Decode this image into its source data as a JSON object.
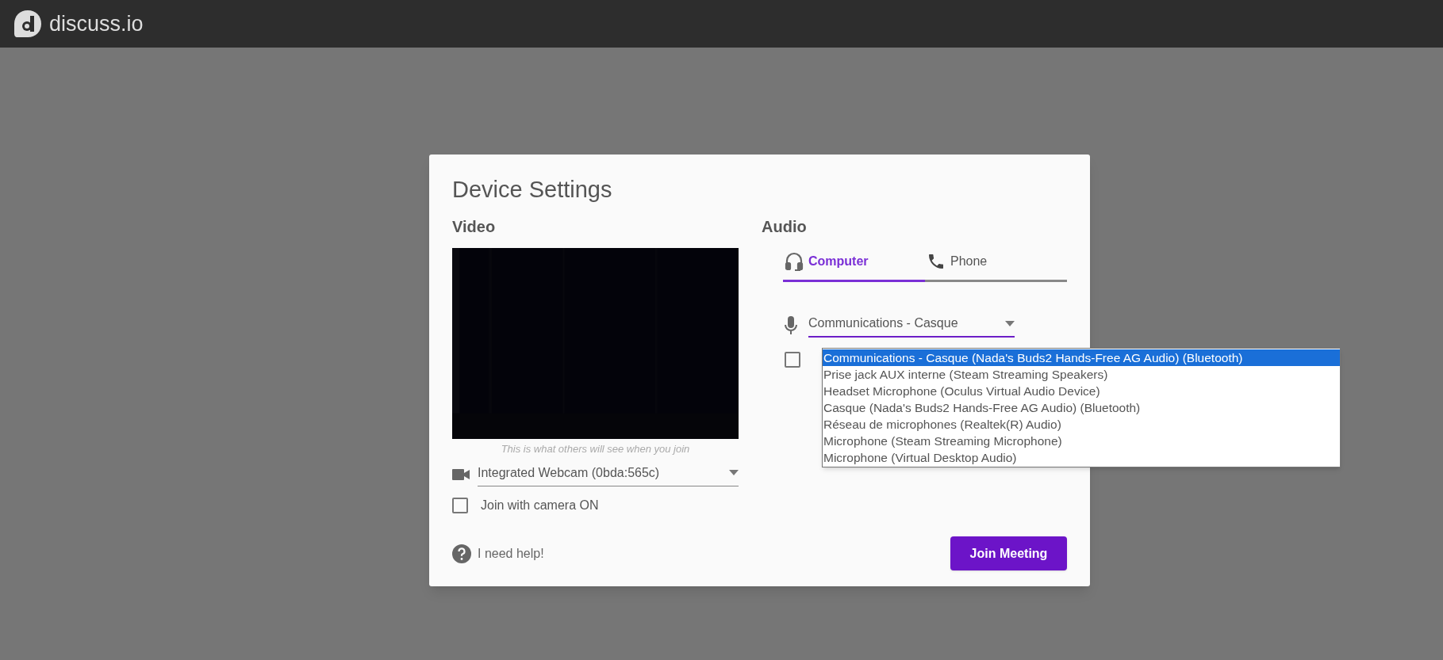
{
  "header": {
    "logo_text": "discuss.io"
  },
  "dialog": {
    "title": "Device Settings",
    "video": {
      "heading": "Video",
      "caption": "This is what others will see when you join",
      "camera_select": {
        "value": "Integrated Webcam (0bda:565c)"
      },
      "join_camera_on": {
        "label": "Join with camera ON",
        "checked": false
      }
    },
    "audio": {
      "heading": "Audio",
      "tabs": [
        {
          "label": "Computer",
          "kind": "headset",
          "selected": true
        },
        {
          "label": "Phone",
          "kind": "phone",
          "selected": false
        }
      ],
      "mic_select": {
        "value": "Communications - Casque",
        "expanded": true,
        "options": [
          {
            "label": "Communications - Casque (Nada's Buds2 Hands-Free AG Audio) (Bluetooth)",
            "selected": true
          },
          {
            "label": "Prise jack AUX interne (Steam Streaming Speakers)",
            "selected": false
          },
          {
            "label": "Headset Microphone (Oculus Virtual Audio Device)",
            "selected": false
          },
          {
            "label": "Casque (Nada's Buds2 Hands-Free AG Audio) (Bluetooth)",
            "selected": false
          },
          {
            "label": "Réseau de microphones (Realtek(R) Audio)",
            "selected": false
          },
          {
            "label": "Microphone (Steam Streaming Microphone)",
            "selected": false
          },
          {
            "label": "Microphone (Virtual Desktop Audio)",
            "selected": false
          }
        ]
      },
      "second_checkbox": {
        "checked": false
      }
    },
    "help_link": "I need help!",
    "join_button": "Join Meeting"
  }
}
